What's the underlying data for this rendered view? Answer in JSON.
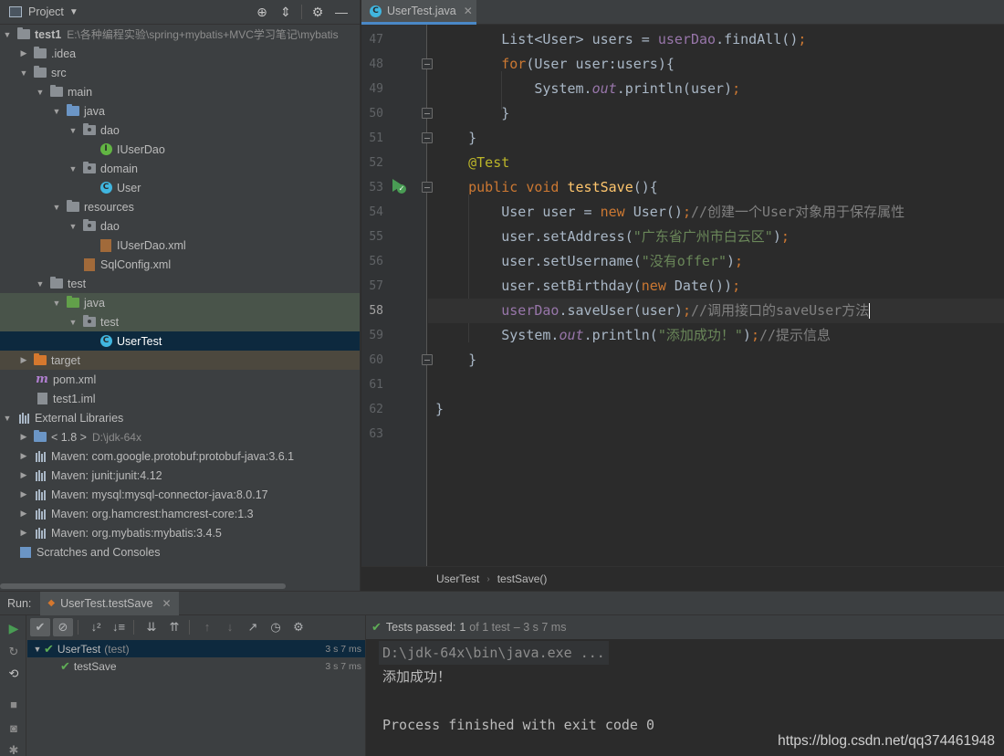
{
  "project_panel": {
    "title": "Project",
    "tree": [
      {
        "label": "test1",
        "sub": "E:\\各种编程实验\\spring+mybatis+MVC学习笔记\\mybatis",
        "bold": true
      },
      {
        "label": ".idea"
      },
      {
        "label": "src"
      },
      {
        "label": "main"
      },
      {
        "label": "java"
      },
      {
        "label": "dao"
      },
      {
        "label": "IUserDao"
      },
      {
        "label": "domain"
      },
      {
        "label": "User"
      },
      {
        "label": "resources"
      },
      {
        "label": "dao"
      },
      {
        "label": "IUserDao.xml"
      },
      {
        "label": "SqlConfig.xml"
      },
      {
        "label": "test"
      },
      {
        "label": "java"
      },
      {
        "label": "test"
      },
      {
        "label": "UserTest"
      },
      {
        "label": "target"
      },
      {
        "label": "pom.xml"
      },
      {
        "label": "test1.iml"
      },
      {
        "label": "External Libraries"
      },
      {
        "label": "< 1.8 >",
        "sub": "D:\\jdk-64x"
      },
      {
        "label": "Maven: com.google.protobuf:protobuf-java:3.6.1"
      },
      {
        "label": "Maven: junit:junit:4.12"
      },
      {
        "label": "Maven: mysql:mysql-connector-java:8.0.17"
      },
      {
        "label": "Maven: org.hamcrest:hamcrest-core:1.3"
      },
      {
        "label": "Maven: org.mybatis:mybatis:3.4.5"
      },
      {
        "label": "Scratches and Consoles"
      }
    ]
  },
  "editor": {
    "tab_label": "UserTest.java",
    "line_numbers": [
      "47",
      "48",
      "49",
      "50",
      "51",
      "52",
      "53",
      "54",
      "55",
      "56",
      "57",
      "58",
      "59",
      "60",
      "61",
      "62",
      "63"
    ],
    "breadcrumb": [
      "UserTest",
      "testSave()"
    ]
  },
  "run_window": {
    "title": "Run:",
    "tab_label": "UserTest.testSave",
    "status_text": "Tests passed:",
    "status_count": "1",
    "status_of": "of 1 test",
    "status_time": "– 3 s 7 ms",
    "tests": [
      {
        "label": "UserTest",
        "sub": "(test)",
        "time": "3 s 7 ms"
      },
      {
        "label": "testSave",
        "sub": "",
        "time": "3 s 7 ms"
      }
    ],
    "console": [
      "D:\\jdk-64x\\bin\\java.exe ...",
      "添加成功！",
      "",
      "Process finished with exit code 0"
    ]
  },
  "watermark": "https://blog.csdn.net/qq374461948",
  "colors": {
    "keyword": "#cc7832",
    "string": "#6a8759",
    "comment": "#808080",
    "field": "#9876aa",
    "annotation": "#bbb529",
    "method_decl": "#ffc66d",
    "pass_green": "#5fad56"
  }
}
